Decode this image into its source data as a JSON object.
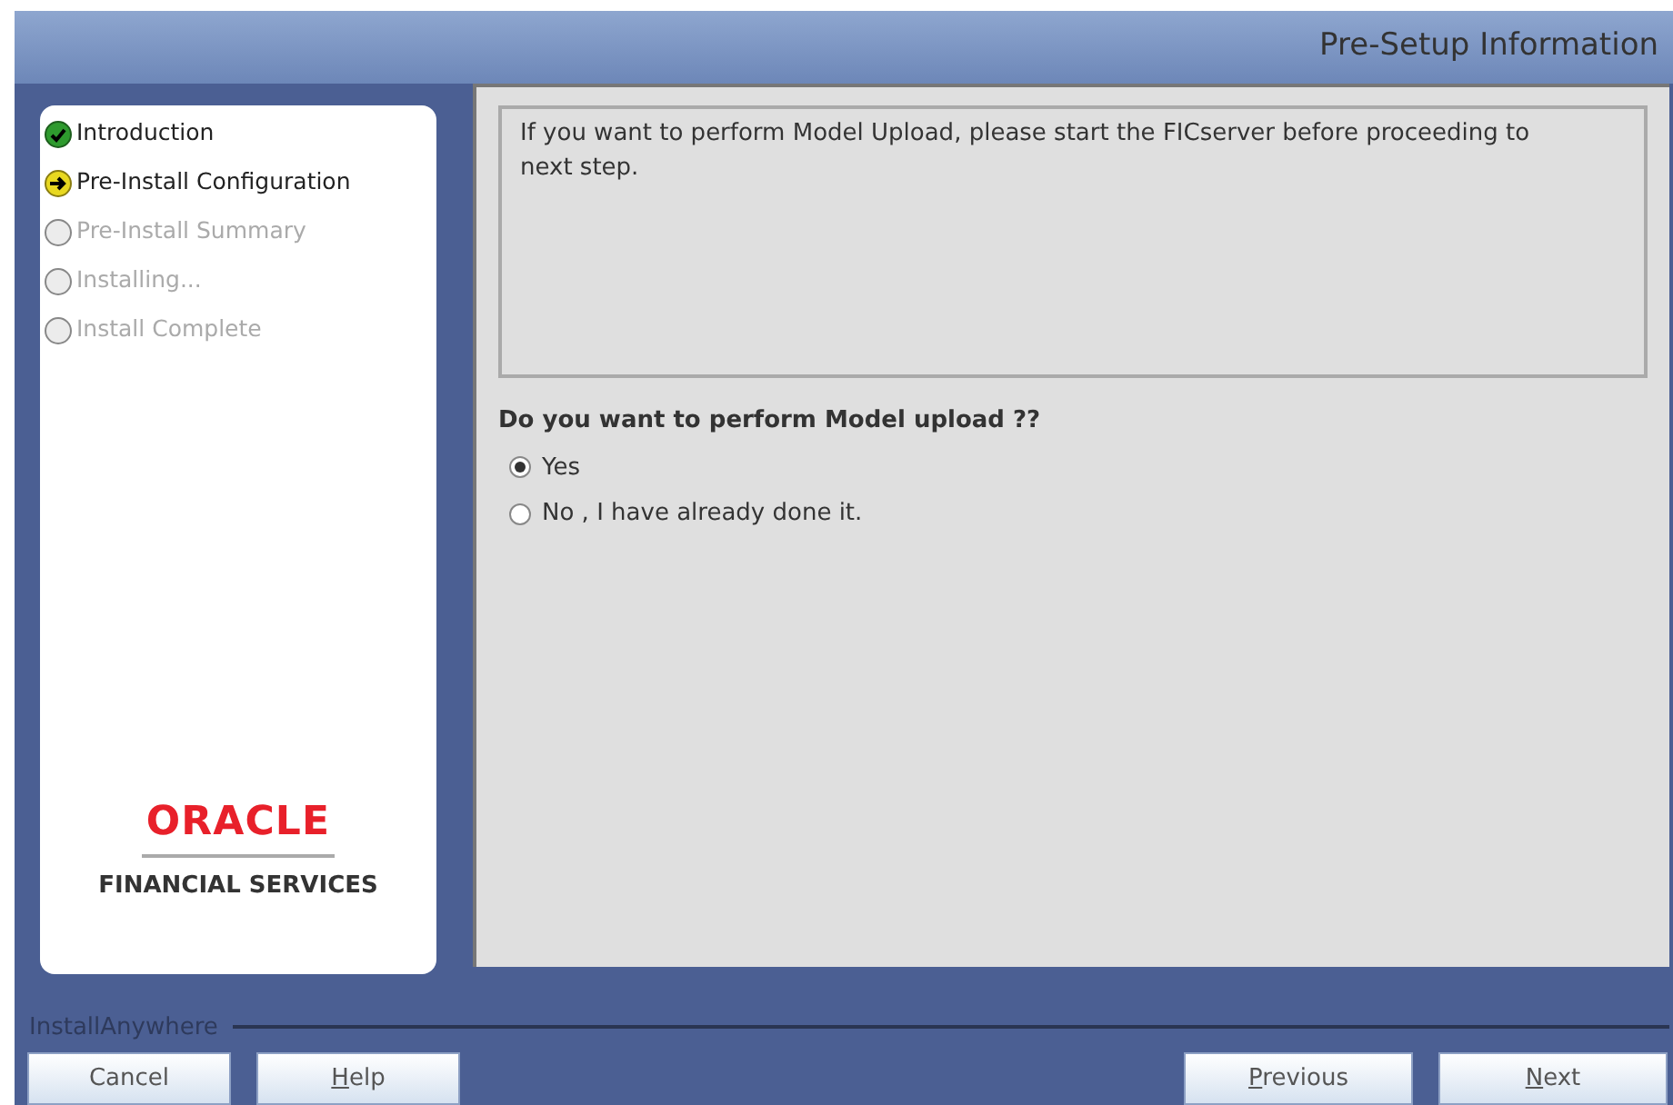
{
  "window": {
    "title": "Pre-Setup Information"
  },
  "steps": [
    {
      "label": "Introduction",
      "kind": "done"
    },
    {
      "label": "Pre-Install Configuration",
      "kind": "current"
    },
    {
      "label": "Pre-Install Summary",
      "kind": "pending"
    },
    {
      "label": "Installing...",
      "kind": "pending"
    },
    {
      "label": "Install Complete",
      "kind": "pending"
    }
  ],
  "logo": {
    "brand": "ORACLE",
    "tagline": "FINANCIAL SERVICES"
  },
  "message": "If you want to perform Model Upload, please start the FICserver before proceeding to next step.",
  "question": "Do you want to perform Model upload ??",
  "options": [
    {
      "label": "Yes",
      "selected": true
    },
    {
      "label": "No , I have already done it.",
      "selected": false
    }
  ],
  "footer_label": "InstallAnywhere",
  "buttons_left": [
    {
      "label": "Cancel",
      "mnemonic": false
    },
    {
      "label": "Help",
      "mnemonic": true
    }
  ],
  "buttons_right": [
    {
      "label": "Previous",
      "mnemonic": true
    },
    {
      "label": "Next",
      "mnemonic": true
    }
  ]
}
